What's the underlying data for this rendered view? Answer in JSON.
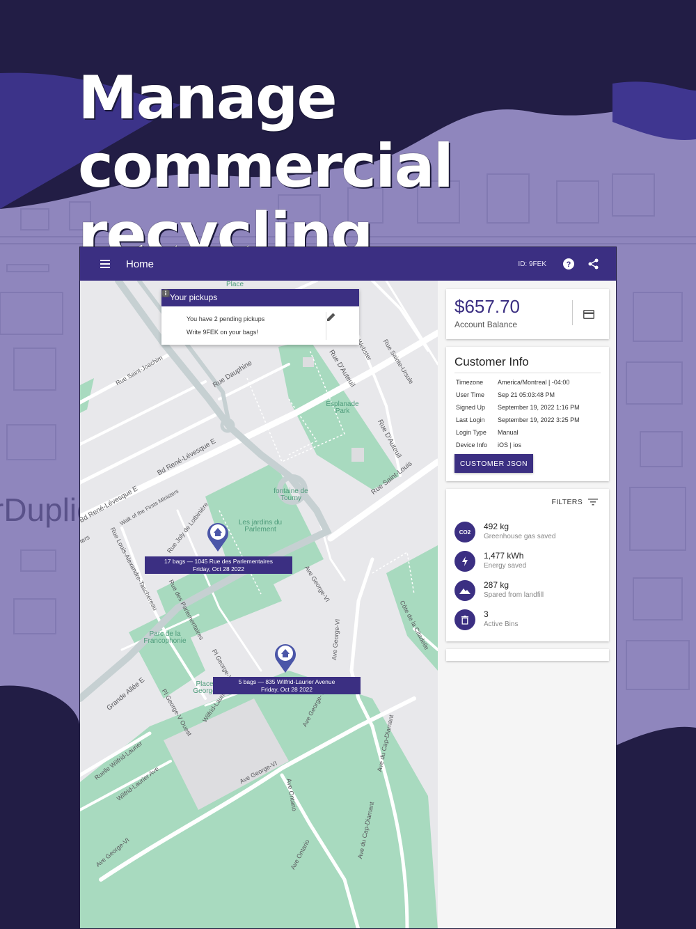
{
  "headline": {
    "line1": "Manage commercial",
    "line2": "recycling"
  },
  "background_watermark": "rDuplic",
  "app_bar": {
    "title": "Home",
    "id_label": "ID: 9FEK"
  },
  "pickups": {
    "header": "Your pickups",
    "row1": "You have 2 pending pickups",
    "row2": "Write 9FEK on your bags!"
  },
  "markers": [
    {
      "line1": "17 bags — 1045 Rue des Parlementaires",
      "line2": "Friday, Oct 28 2022"
    },
    {
      "line1": "5 bags — 835 Wilfrid-Laurier Avenue",
      "line2": "Friday, Oct 28 2022"
    }
  ],
  "map_labels": {
    "rue_saint_joachim": "Rue Saint-Joachim",
    "rue_dauphine": "Rue Dauphine",
    "rue_dauteuil_1": "Rue D'Auteuil",
    "rue_dauteuil_2": "Rue D'Auteuil",
    "rue_webster": "Webster",
    "rue_sainte_ursule": "Rue Sainte-Ursule",
    "rue_saint_louis": "Rue Saint-Louis",
    "bd_rene_levesque_1": "Bd René-Lévesque E",
    "bd_rene_levesque_2": "Bd René-Lévesque E",
    "walk_first_ministers": "Walk of the Firsts Ministers",
    "rue_joly": "Rue Joly de Lotbinière",
    "rue_taschereau": "Rue Louis-Alexandre-Taschereau",
    "rue_parlementaires": "Rue des Parlementaires",
    "ave_george_vi_1": "Ave George-VI",
    "ave_george_vi_2": "Ave George-VI",
    "ave_george_vi_3": "Ave George-VI",
    "ave_george_vi_4": "Ave George-VI",
    "ave_george_vi_5": "Ave George-VI",
    "cote_citadelle": "Côte de la Citadelle",
    "pl_george_v_est": "Pl George-V Est",
    "pl_george_v_ouest": "Pl George-V Ouest",
    "wilfrid_laurier": "Wilfrid-Laurier",
    "grande_allee": "Grande Allée E",
    "ruelle_wilfrid": "Ruelle Wilfrid-Laurier",
    "wilfrid_laurier_ave": "Wilfrid-Laurier Ave",
    "ave_ontario_1": "Ave Ontario",
    "ave_ontario_2": "Ave Ontario",
    "ave_cap_diamant_1": "Ave du Cap-Diamant",
    "ave_cap_diamant_2": "Ave du Cap-Diamant",
    "place_top": "Place",
    "ters": "ters"
  },
  "park_labels": {
    "esplanade": "Esplanade Park",
    "fontaine": "fontaine de Tourny",
    "jardins": "Les jardins du Parlement",
    "francophonie": "Parc de la Francophonie",
    "place_george": "Place George"
  },
  "balance": {
    "amount": "$657.70",
    "label": "Account Balance"
  },
  "customer_info": {
    "title": "Customer Info",
    "rows": [
      {
        "key": "Timezone",
        "value": "America/Montreal | -04:00"
      },
      {
        "key": "User Time",
        "value": "Sep 21 05:03:48 PM"
      },
      {
        "key": "Signed Up",
        "value": "September 19, 2022 1:16 PM"
      },
      {
        "key": "Last Login",
        "value": "September 19, 2022 3:25 PM"
      },
      {
        "key": "Login Type",
        "value": "Manual"
      },
      {
        "key": "Device Info",
        "value": "iOS | ios"
      }
    ],
    "button": "CUSTOMER JSON"
  },
  "stats": {
    "filters_label": "FILTERS",
    "items": [
      {
        "icon": "co2-icon",
        "icon_text": "CO2",
        "value": "492 kg",
        "label": "Greenhouse gas saved"
      },
      {
        "icon": "lightning-icon",
        "value": "1,477 kWh",
        "label": "Energy saved"
      },
      {
        "icon": "mountain-icon",
        "value": "287 kg",
        "label": "Spared from landfill"
      },
      {
        "icon": "trash-icon",
        "value": "3",
        "label": "Active Bins"
      }
    ]
  },
  "colors": {
    "brand": "#3b2f82",
    "background": "#8f86bd",
    "dark": "#221d45",
    "park": "#a8dabf",
    "road": "#ffffff",
    "map_bg": "#e8e8eb"
  }
}
